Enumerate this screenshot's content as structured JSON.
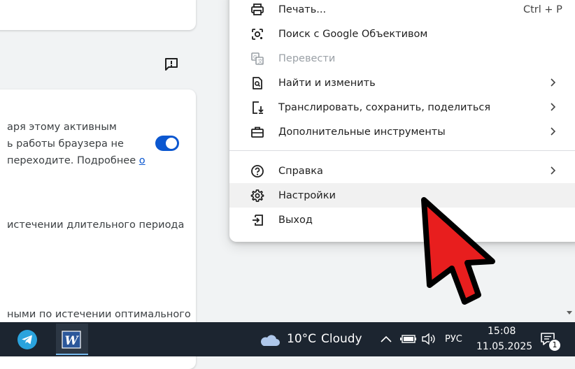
{
  "background": {
    "lines": [
      "аря этому активным",
      "ь работы браузера не",
      "переходите. Подробнее",
      "истечении длительного периода",
      "ными по истечении оптимального"
    ],
    "link_text": "о"
  },
  "menu": {
    "items": [
      {
        "label": "Печать...",
        "shortcut": "Ctrl + P",
        "icon": "printer-icon"
      },
      {
        "label": "Поиск с Google Объективом",
        "icon": "google-lens-icon"
      },
      {
        "label": "Перевести",
        "icon": "translate-icon",
        "disabled": true
      },
      {
        "label": "Найти и изменить",
        "icon": "find-icon",
        "submenu": true
      },
      {
        "label": "Транслировать, сохранить, поделиться",
        "icon": "cast-save-icon",
        "submenu": true
      },
      {
        "label": "Дополнительные инструменты",
        "icon": "toolbox-icon",
        "submenu": true
      },
      {
        "label": "Справка",
        "icon": "help-icon",
        "submenu": true
      },
      {
        "label": "Настройки",
        "icon": "gear-icon",
        "hovered": true
      },
      {
        "label": "Выход",
        "icon": "exit-icon"
      }
    ]
  },
  "taskbar": {
    "weather_temp": "10°C",
    "weather_desc": "Cloudy",
    "language": "РУС",
    "time": "15:08",
    "date": "11.05.2025",
    "notification_count": "1"
  },
  "colors": {
    "accent": "#0b57d0",
    "taskbar": "#1c2530",
    "cursor": "#e81e1e"
  }
}
